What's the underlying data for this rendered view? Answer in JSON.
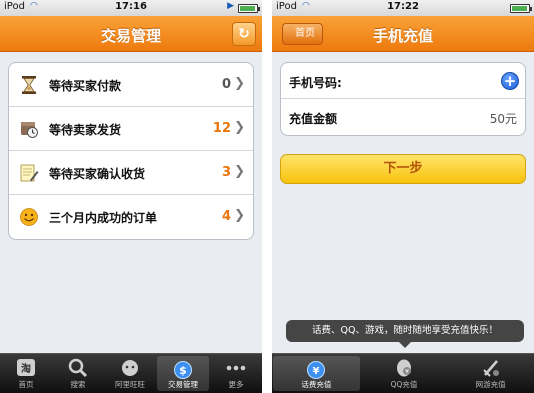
{
  "left": {
    "status": {
      "carrier": "iPod",
      "time": "17:16"
    },
    "title": "交易管理",
    "rows": [
      {
        "label": "等待买家付款",
        "count": "0",
        "count_color": "#555555"
      },
      {
        "label": "等待卖家发货",
        "count": "12",
        "count_color": "#e8760a"
      },
      {
        "label": "等待买家确认收货",
        "count": "3",
        "count_color": "#e8760a"
      },
      {
        "label": "三个月内成功的订单",
        "count": "4",
        "count_color": "#e8760a"
      }
    ],
    "tabs": [
      "首页",
      "搜索",
      "阿里旺旺",
      "交易管理",
      "更多"
    ],
    "active_tab": 3
  },
  "right": {
    "status": {
      "carrier": "iPod",
      "time": "17:22"
    },
    "title": "手机充值",
    "back_label": "首页",
    "fields": {
      "phone_label": "手机号码:",
      "amount_label": "充值金额",
      "amount_value": "50元"
    },
    "next_label": "下一步",
    "tip": "话费、QQ、游戏，随时随地享受充值快乐！",
    "tabs": [
      "话费充值",
      "QQ充值",
      "网游充值"
    ],
    "active_tab": 0
  },
  "colors": {
    "accent_orange": "#ee7a0e",
    "count_orange": "#e8760a",
    "button_yellow": "#f7c20c"
  }
}
